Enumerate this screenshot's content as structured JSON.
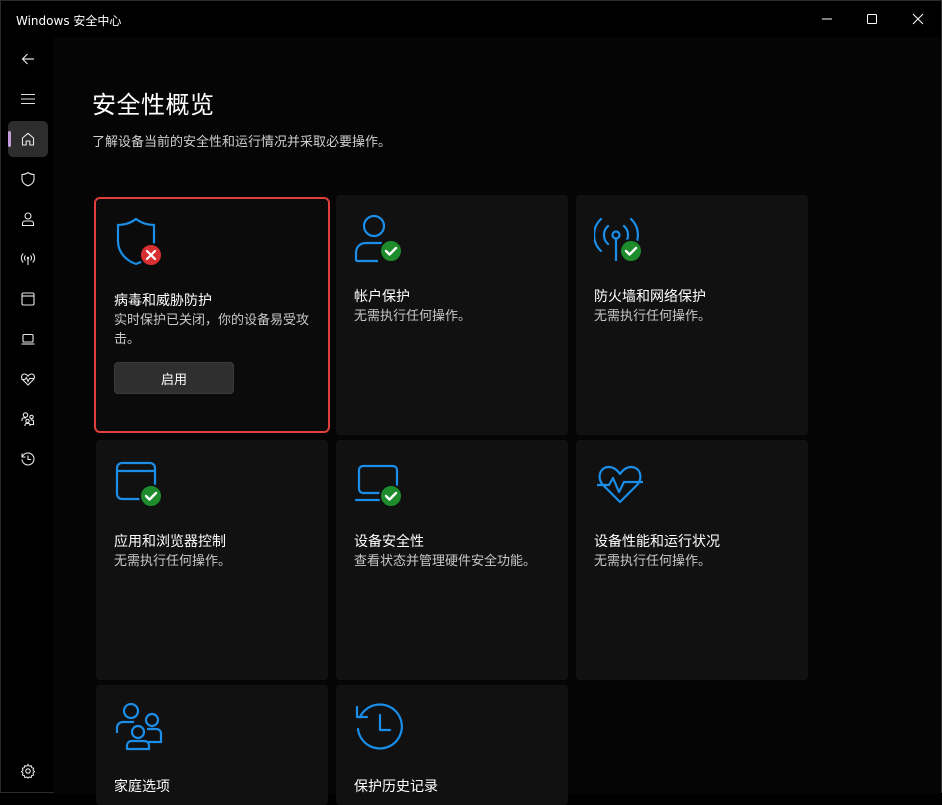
{
  "window": {
    "title": "Windows 安全中心",
    "controls": [
      "minimize",
      "maximize",
      "close"
    ]
  },
  "nav": {
    "items": [
      {
        "name": "back",
        "icon": "back-arrow-icon"
      },
      {
        "name": "menu",
        "icon": "hamburger-icon"
      },
      {
        "name": "home",
        "icon": "home-icon",
        "active": true
      },
      {
        "name": "virus",
        "icon": "shield-icon"
      },
      {
        "name": "account",
        "icon": "person-icon"
      },
      {
        "name": "firewall",
        "icon": "antenna-icon"
      },
      {
        "name": "app-browser",
        "icon": "browser-window-icon"
      },
      {
        "name": "device-security",
        "icon": "laptop-icon"
      },
      {
        "name": "device-health",
        "icon": "heart-pulse-icon"
      },
      {
        "name": "family",
        "icon": "family-icon"
      },
      {
        "name": "history",
        "icon": "history-icon"
      },
      {
        "name": "settings",
        "icon": "gear-icon"
      }
    ]
  },
  "page": {
    "title": "安全性概览",
    "subtitle": "了解设备当前的安全性和运行情况并采取必要操作。"
  },
  "cards": [
    {
      "title": "病毒和威胁防护",
      "desc": "实时保护已关闭，你的设备易受攻击。",
      "status": "error",
      "icon": "shield-icon",
      "button": "启用"
    },
    {
      "title": "帐户保护",
      "desc": "无需执行任何操作。",
      "status": "ok",
      "icon": "person-icon"
    },
    {
      "title": "防火墙和网络保护",
      "desc": "无需执行任何操作。",
      "status": "ok",
      "icon": "antenna-icon"
    },
    {
      "title": "应用和浏览器控制",
      "desc": "无需执行任何操作。",
      "status": "ok",
      "icon": "browser-window-icon"
    },
    {
      "title": "设备安全性",
      "desc": "查看状态并管理硬件安全功能。",
      "status": "ok",
      "icon": "laptop-icon"
    },
    {
      "title": "设备性能和运行状况",
      "desc": "无需执行任何操作。",
      "status": "ok",
      "icon": "heart-pulse-icon"
    },
    {
      "title": "家庭选项",
      "desc": "",
      "status": "none",
      "icon": "family-icon"
    },
    {
      "title": "保护历史记录",
      "desc": "",
      "status": "none",
      "icon": "history-icon"
    }
  ],
  "colors": {
    "accent_icon": "#1a8ee8",
    "ok_badge": "#1e8b2c",
    "error_badge": "#d63031",
    "alert_outline": "#e0403b",
    "nav_active_indicator": "#c49bd8"
  }
}
